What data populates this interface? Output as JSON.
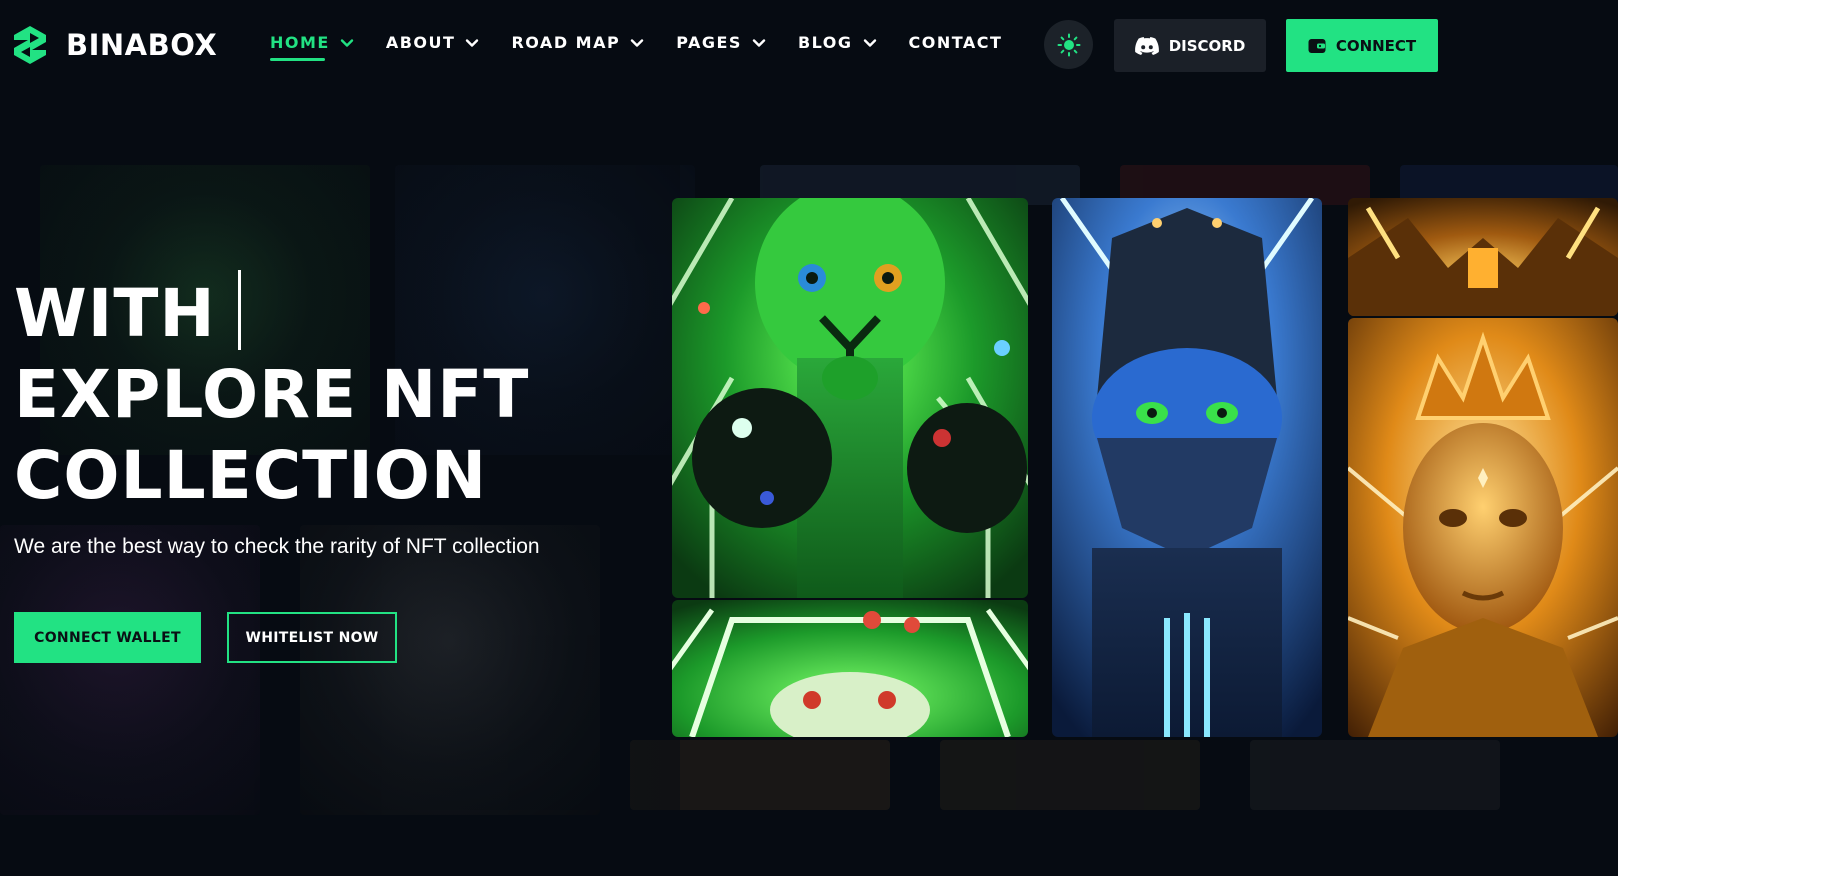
{
  "brand": {
    "name": "BINABOX"
  },
  "nav": [
    {
      "label": "HOME",
      "active": true,
      "has_dropdown": true
    },
    {
      "label": "ABOUT",
      "active": false,
      "has_dropdown": true
    },
    {
      "label": "ROAD MAP",
      "active": false,
      "has_dropdown": true
    },
    {
      "label": "PAGES",
      "active": false,
      "has_dropdown": true
    },
    {
      "label": "BLOG",
      "active": false,
      "has_dropdown": true
    },
    {
      "label": "CONTACT",
      "active": false,
      "has_dropdown": false
    }
  ],
  "header_actions": {
    "theme_icon": "sun-icon",
    "discord_label": "DISCORD",
    "discord_icon": "discord-icon",
    "connect_label": "CONNECT",
    "connect_icon": "wallet-icon"
  },
  "hero": {
    "line1": "WITH",
    "line2": "EXPLORE NFT",
    "line3": "COLLECTION",
    "subtitle": "We are the best way to check the rarity of NFT collection",
    "cta_primary": "CONNECT WALLET",
    "cta_secondary": "WHITELIST NOW"
  },
  "gallery": {
    "cards": [
      {
        "theme": "green-alien-character",
        "accent": "#2fd13a"
      },
      {
        "theme": "green-alien-gamepad",
        "accent": "#2fd13a"
      },
      {
        "theme": "blue-masked-character",
        "accent": "#2e6fe0"
      },
      {
        "theme": "golden-machine-detail",
        "accent": "#f0a020"
      },
      {
        "theme": "golden-queen-character",
        "accent": "#f0a020"
      }
    ]
  },
  "colors": {
    "accent": "#22e283",
    "background": "#060b12",
    "button_dark": "#1b2028"
  }
}
